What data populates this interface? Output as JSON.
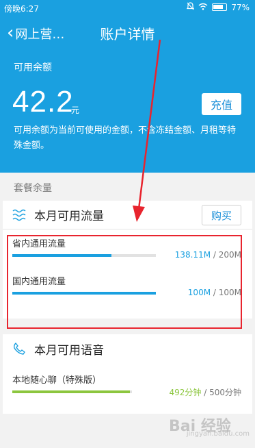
{
  "status_bar": {
    "time": "傍晚6:27",
    "battery": "77%"
  },
  "header": {
    "back_label": "网上营…",
    "title": "账户详情"
  },
  "balance": {
    "label": "可用余额",
    "amount": "42.2",
    "unit": "元",
    "recharge_label": "充值",
    "note": "可用余额为当前可使用的金额，不含冻结金额、月租等特殊金额。"
  },
  "package_label": "套餐余量",
  "data_card": {
    "title": "本月可用流量",
    "buy_label": "购买",
    "items": [
      {
        "name": "省内通用流量",
        "used": "138.11M",
        "total": "200M",
        "fraction": 0.69
      },
      {
        "name": "国内通用流量",
        "used": "100M",
        "total": "100M",
        "fraction": 1.0
      }
    ]
  },
  "voice_card": {
    "title": "本月可用语音",
    "items": [
      {
        "name": "本地随心聊（特殊版）",
        "used": "492分钟",
        "total": "500分钟",
        "fraction": 0.984
      }
    ]
  },
  "colors": {
    "accent": "#1aa0e0",
    "voice_green": "#8cc63f",
    "annotation_red": "#e8242e"
  },
  "watermark": {
    "main": "Bai 经验",
    "sub": "jingyan.baidu.com"
  }
}
